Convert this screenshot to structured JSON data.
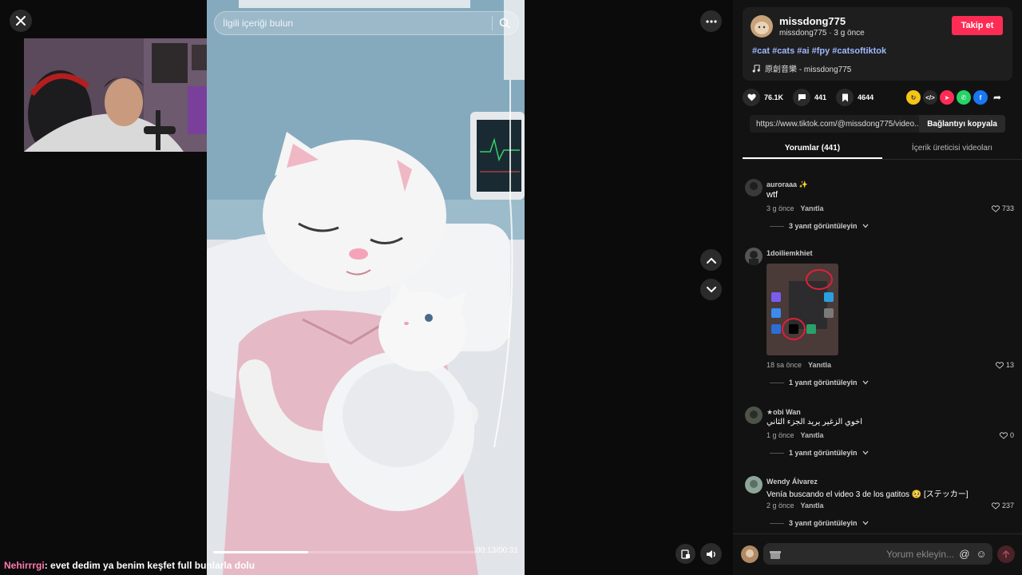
{
  "stage": {
    "search_placeholder": "İlgili içeriği bulun",
    "time": "00:13/00:31",
    "progress": 0.36
  },
  "chat": {
    "user": "Nehirrrgi",
    "message": ": evet dedim ya benim keşfet full bunlarla dolu"
  },
  "video_info": {
    "author": "missdong775",
    "author_sub": "missdong775 · 3 g önce",
    "follow_label": "Takip et",
    "hashtags": "#cat #cats #ai #fpy #catsoftiktok",
    "music": "原創音樂 - missdong775"
  },
  "stats": {
    "likes": "76.1K",
    "comments": "441",
    "saves": "4644"
  },
  "link": {
    "url": "https://www.tiktok.com/@missdong775/video...",
    "copy_label": "Bağlantıyı kopyala"
  },
  "tabs": [
    "Yorumlar (441)",
    "İçerik üreticisi videoları"
  ],
  "comments": [
    {
      "user": "auroraaa ✨",
      "text": "wtf",
      "time": "3 g önce",
      "reply": "Yanıtla",
      "likes": "733",
      "replies": "3 yanıt görüntüleyin"
    },
    {
      "user": "1doiliemkhiet",
      "text": "",
      "time": "18 sa önce",
      "reply": "Yanıtla",
      "likes": "13",
      "replies": "1 yanıt görüntüleyin"
    },
    {
      "user": "★obi Wan",
      "text": "اخوي الزغير يريد الجزء الثاني",
      "time": "1 g önce",
      "reply": "Yanıtla",
      "likes": "0",
      "replies": "1 yanıt görüntüleyin"
    },
    {
      "user": "Wendy Álvarez",
      "text": "Venía buscando el video 3 de los gatitos 🥺 [ステッカー]",
      "time": "2 g önce",
      "reply": "Yanıtla",
      "likes": "237",
      "replies": "3 yanıt görüntüleyin"
    }
  ],
  "comment_input": {
    "placeholder": "Yorum ekleyin..."
  },
  "colors": {
    "follow": "#fe2c55",
    "hashtag": "#9fb8ff",
    "chat_user": "#ff7ab0"
  }
}
